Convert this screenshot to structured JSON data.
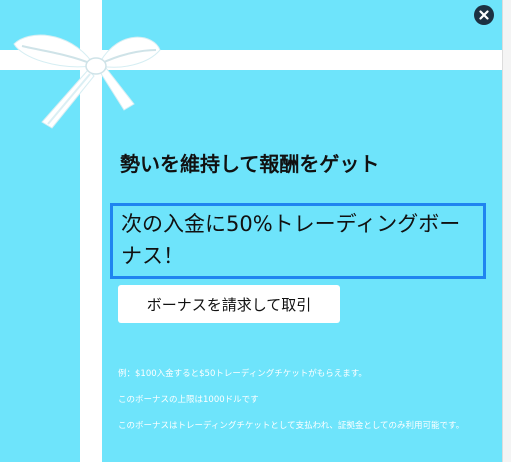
{
  "colors": {
    "background": "#6ee4fb",
    "ribbon": "#ffffff",
    "offer_border": "#1f84f0",
    "close_button": "#1c3142"
  },
  "popup": {
    "close_icon": "close-x-icon",
    "headline": "勢いを維持して報酬をゲット",
    "offer_text": "次の入金に50%トレーディングボーナス！",
    "claim_button_label": "ボーナスを請求して取引",
    "fine_print": [
      "例：$100入金すると$50トレーディングチケットがもらえます。",
      "このボーナスの上限は1000ドルです",
      "このボーナスはトレーディングチケットとして支払われ、証拠金としてのみ利用可能です。"
    ]
  }
}
